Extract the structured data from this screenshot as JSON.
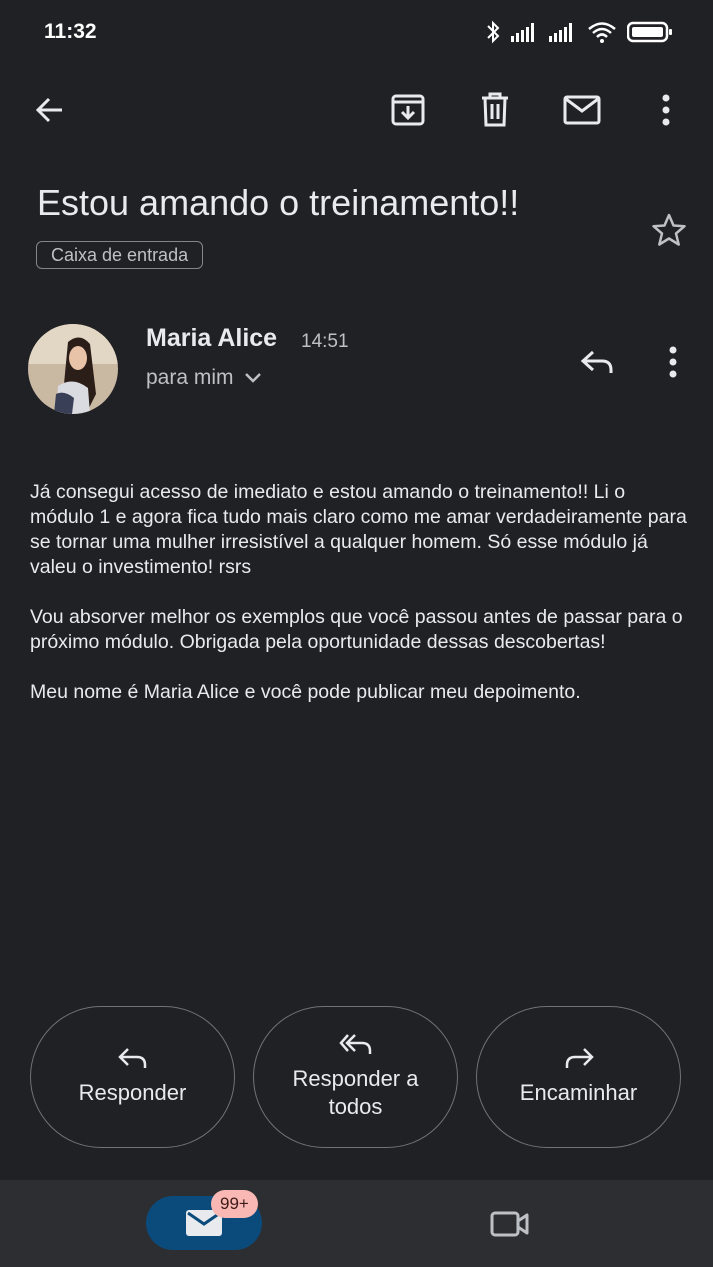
{
  "status_bar": {
    "time": "11:32"
  },
  "toolbar": {
    "back": "arrow-back-icon",
    "archive": "archive-icon",
    "delete": "trash-icon",
    "mark_unread": "mail-icon",
    "more": "more-vert-icon"
  },
  "email": {
    "subject": "Estou amando o treinamento!!",
    "label": "Caixa de entrada",
    "sender": "Maria Alice",
    "time": "14:51",
    "recipient": "para mim",
    "body": [
      "Já consegui acesso de imediato e estou amando o treinamento!! Li o módulo 1 e agora fica tudo mais claro como me amar verdadeiramente para se tornar uma mulher irresistível a qualquer homem. Só esse módulo já valeu o investimento! rsrs",
      "Vou absorver melhor os exemplos que você passou antes de passar para o próximo módulo. Obrigada pela oportunidade dessas descobertas!",
      "Meu nome é Maria Alice e você pode publicar meu depoimento."
    ]
  },
  "actions": {
    "reply": "Responder",
    "reply_all": "Responder a todos",
    "forward": "Encaminhar"
  },
  "bottom_nav": {
    "mail_badge": "99+"
  },
  "colors": {
    "background": "#202124",
    "accent_pill": "#0b4b7c",
    "badge": "#f9b8b3"
  }
}
